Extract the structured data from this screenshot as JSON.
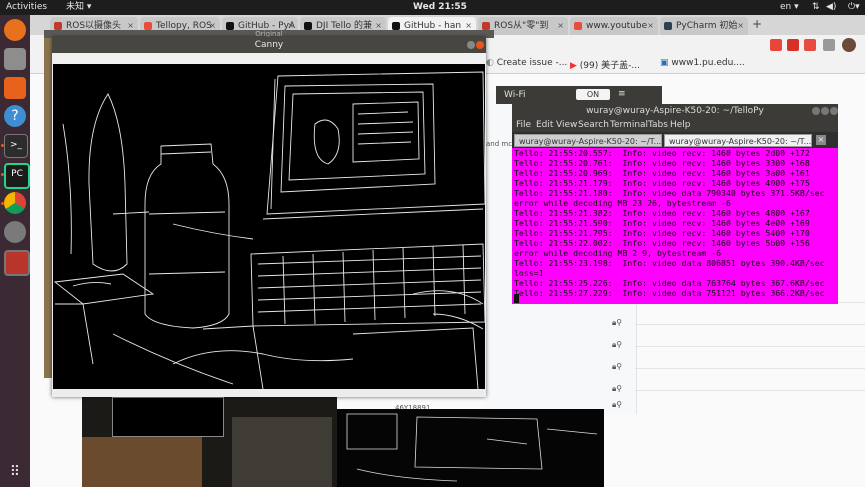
{
  "topbar": {
    "activities": "Activities",
    "app_menu": "未知",
    "clock": "Wed 21:55",
    "lang": "en"
  },
  "chrome": {
    "tabs": [
      {
        "label": "ROS以摄像头",
        "fav_color": "#c0392b"
      },
      {
        "label": "Tellopy, ROS",
        "fav_color": "#e74c3c"
      },
      {
        "label": "GitHub - PyA",
        "fav_color": "#111111"
      },
      {
        "label": "DJI Tello 的兼",
        "fav_color": "#111111"
      },
      {
        "label": "GitHub - han",
        "fav_color": "#111111"
      },
      {
        "label": "ROS从\"零\"到",
        "fav_color": "#c0392b"
      },
      {
        "label": "www.youtube",
        "fav_color": "#e74c3c"
      },
      {
        "label": "PyCharm 初始",
        "fav_color": "#2c3e50"
      }
    ],
    "new_tab": "+",
    "bookmarks": [
      "Create issue -...",
      "(99) 美子盖-...",
      "www1.pu.edu...."
    ],
    "list_tag": "46Y18891",
    "side_text": "and mc"
  },
  "wifi": {
    "label": "Wi-Fi",
    "toggle": "ON"
  },
  "terminal": {
    "title": "wuray@wuray-Aspire-K50-20: ~/TelloPy",
    "menu": [
      "File",
      "Edit",
      "View",
      "Search",
      "Terminal",
      "Tabs",
      "Help"
    ],
    "tabs": [
      "wuray@wuray-Aspire-K50-20: ~/T...",
      "wuray@wuray-Aspire-K50-20: ~/T..."
    ],
    "lines": [
      "Tello: 21:55:20.557:  Info: video recv: 1460 bytes 2d00 +172",
      "Tello: 21:55:20.761:  Info: video recv: 1460 bytes 3300 +168",
      "Tello: 21:55:20.969:  Info: video recv: 1460 bytes 3a00 +161",
      "Tello: 21:55:21.179:  Info: video recv: 1460 bytes 4000 +175",
      "Tello: 21:55:21.180:  Info: video data 790340 bytes 371.5KB/sec",
      "error while decoding MB 23 26, bytestream -6",
      "Tello: 21:55:21.382:  Info: video recv: 1460 bytes 4800 +167",
      "Tello: 21:55:21.590:  Info: video recv: 1460 bytes 4e00 +169",
      "Tello: 21:55:21.795:  Info: video recv: 1460 bytes 5400 +170",
      "Tello: 21:55:22.002:  Info: video recv: 1460 bytes 5b00 +156",
      "error while decoding MB 2 9, bytestream -6",
      "Tello: 21:55:23.198:  Info: video data 806851 bytes 390.4KB/sec",
      "loss=1",
      "Tello: 21:55:25.226:  Info: video data 763764 bytes 367.6KB/sec",
      "Tello: 21:55:27.229:  Info: video data 751121 bytes 366.2KB/sec"
    ]
  },
  "canny": {
    "title": "Canny",
    "behind_title": "Original"
  },
  "dock": {
    "icons": [
      "firefox-icon",
      "files-icon",
      "software-icon",
      "help-icon",
      "terminal-icon",
      "pycharm-icon",
      "chrome-icon",
      "settings-icon",
      "image-viewer-icon",
      "apps-grid-icon"
    ]
  }
}
